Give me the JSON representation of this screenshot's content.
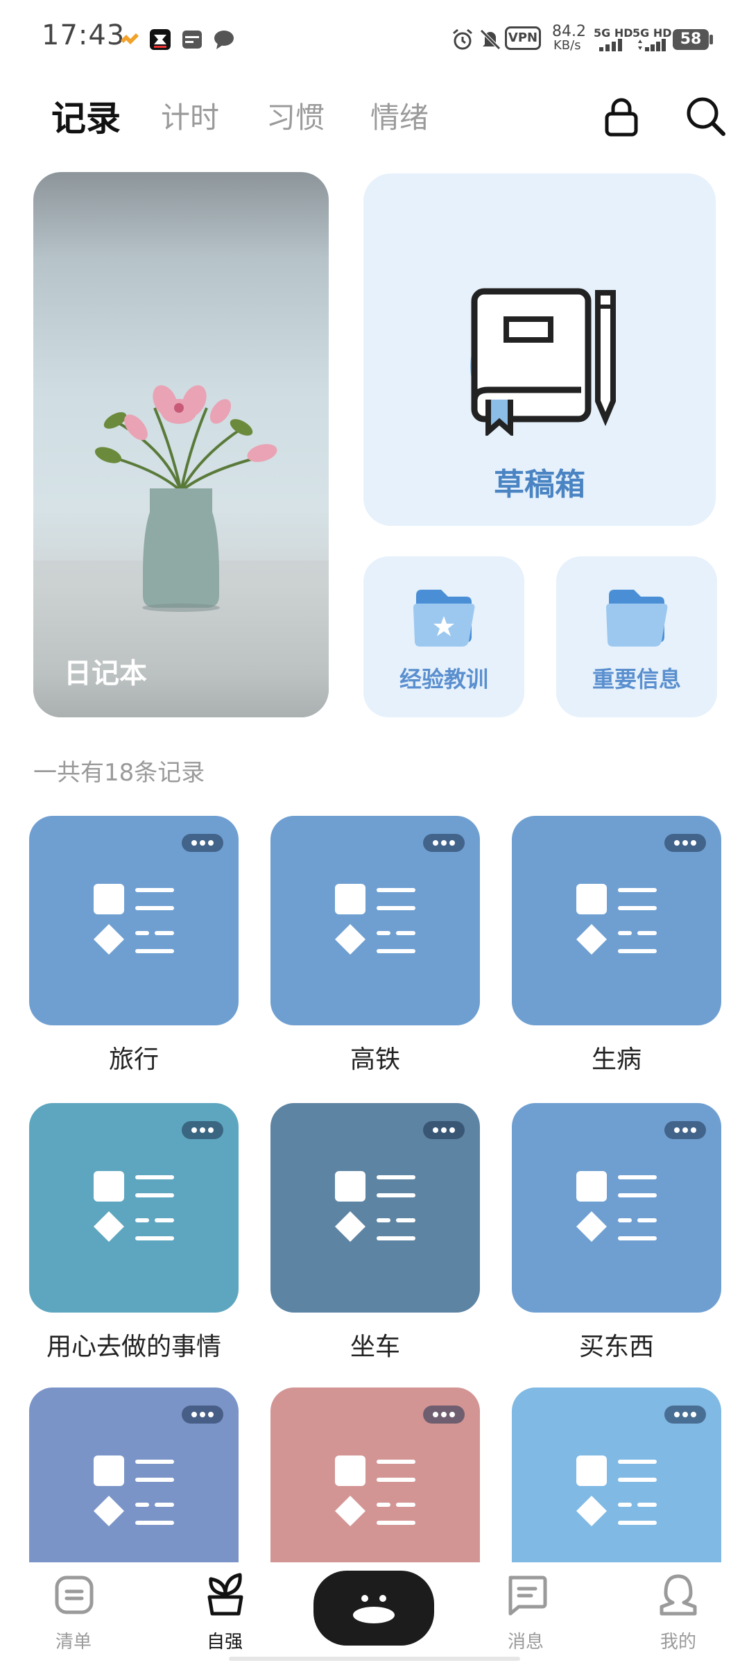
{
  "status_bar": {
    "time": "17:43",
    "vpn": "VPN",
    "speed_value": "84.2",
    "speed_unit": "KB/s",
    "signal1": "5G HD",
    "signal2": "5G HD",
    "battery": "58",
    "icons": [
      "app-icon-orange",
      "app-icon-capcut",
      "app-icon-card",
      "message-icon",
      "alarm-icon",
      "mute-icon"
    ]
  },
  "tabs": [
    {
      "label": "记录",
      "active": true
    },
    {
      "label": "计时",
      "active": false
    },
    {
      "label": "习惯",
      "active": false
    },
    {
      "label": "情绪",
      "active": false
    }
  ],
  "header_icons": [
    "lock-icon",
    "search-icon"
  ],
  "cards": {
    "diary": "日记本",
    "drafts": "草稿箱",
    "lessons": "经验教训",
    "important": "重要信息"
  },
  "record_count": "一共有18条记录",
  "grid": [
    {
      "label": "旅行",
      "color": "#6f9fd1"
    },
    {
      "label": "高铁",
      "color": "#6f9fd1"
    },
    {
      "label": "生病",
      "color": "#6f9fd1"
    },
    {
      "label": "用心去做的事情",
      "color": "#5ea6bf"
    },
    {
      "label": "坐车",
      "color": "#5e84a3"
    },
    {
      "label": "买东西",
      "color": "#6f9fd1"
    },
    {
      "label": "",
      "color": "#7b94c7"
    },
    {
      "label": "",
      "color": "#d39594"
    },
    {
      "label": "",
      "color": "#7fb9e4"
    }
  ],
  "bottom_nav": [
    {
      "label": "清单",
      "icon": "list-icon",
      "active": false
    },
    {
      "label": "自强",
      "icon": "sprout-icon",
      "active": true
    },
    {
      "label": "消息",
      "icon": "chat-icon",
      "active": false
    },
    {
      "label": "我的",
      "icon": "profile-icon",
      "active": false
    }
  ],
  "center_button_icon": "face-icon"
}
